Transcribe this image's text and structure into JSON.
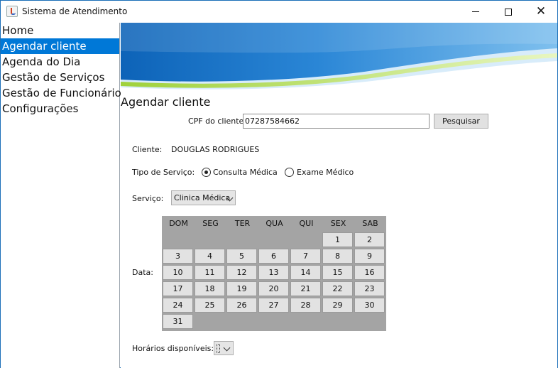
{
  "window": {
    "title": "Sistema de Atendimento",
    "controls": {
      "minimize_icon": "minimize-icon",
      "maximize_icon": "maximize-icon",
      "close_glyph": "✕"
    }
  },
  "sidebar": {
    "items": [
      {
        "label": "Home"
      },
      {
        "label": "Agendar cliente",
        "active": true
      },
      {
        "label": "Agenda do Dia"
      },
      {
        "label": "Gestão de Serviços"
      },
      {
        "label": "Gestão de Funcionários"
      },
      {
        "label": "Configurações"
      }
    ]
  },
  "main": {
    "title": "Agendar cliente",
    "cpf": {
      "label": "CPF do cliente:",
      "value": "07287584662"
    },
    "search_button": "Pesquisar",
    "client": {
      "label": "Cliente:",
      "value": "DOUGLAS RODRIGUES"
    },
    "service_type": {
      "label": "Tipo de Serviço:",
      "options": [
        {
          "label": "Consulta Médica",
          "checked": true
        },
        {
          "label": "Exame Médico",
          "checked": false
        }
      ]
    },
    "service": {
      "label": "Serviço:",
      "value": "Clinica Médica"
    },
    "date_label": "Data:",
    "calendar": {
      "weekdays": [
        "DOM",
        "SEG",
        "TER",
        "QUA",
        "QUI",
        "SEX",
        "SAB"
      ],
      "first_weekday_index": 5,
      "days": [
        "1",
        "2",
        "3",
        "4",
        "5",
        "6",
        "7",
        "8",
        "9",
        "10",
        "11",
        "12",
        "13",
        "14",
        "15",
        "16",
        "17",
        "18",
        "19",
        "20",
        "21",
        "22",
        "23",
        "24",
        "25",
        "26",
        "27",
        "28",
        "29",
        "30",
        "31"
      ]
    },
    "hours": {
      "label": "Horários disponíveis:",
      "value": ""
    }
  },
  "colors": {
    "accent": "#0078d7",
    "calendar_bg": "#a4a4a4",
    "day_bg": "#e2e2e2",
    "banner_blue": "#1a74c8"
  }
}
